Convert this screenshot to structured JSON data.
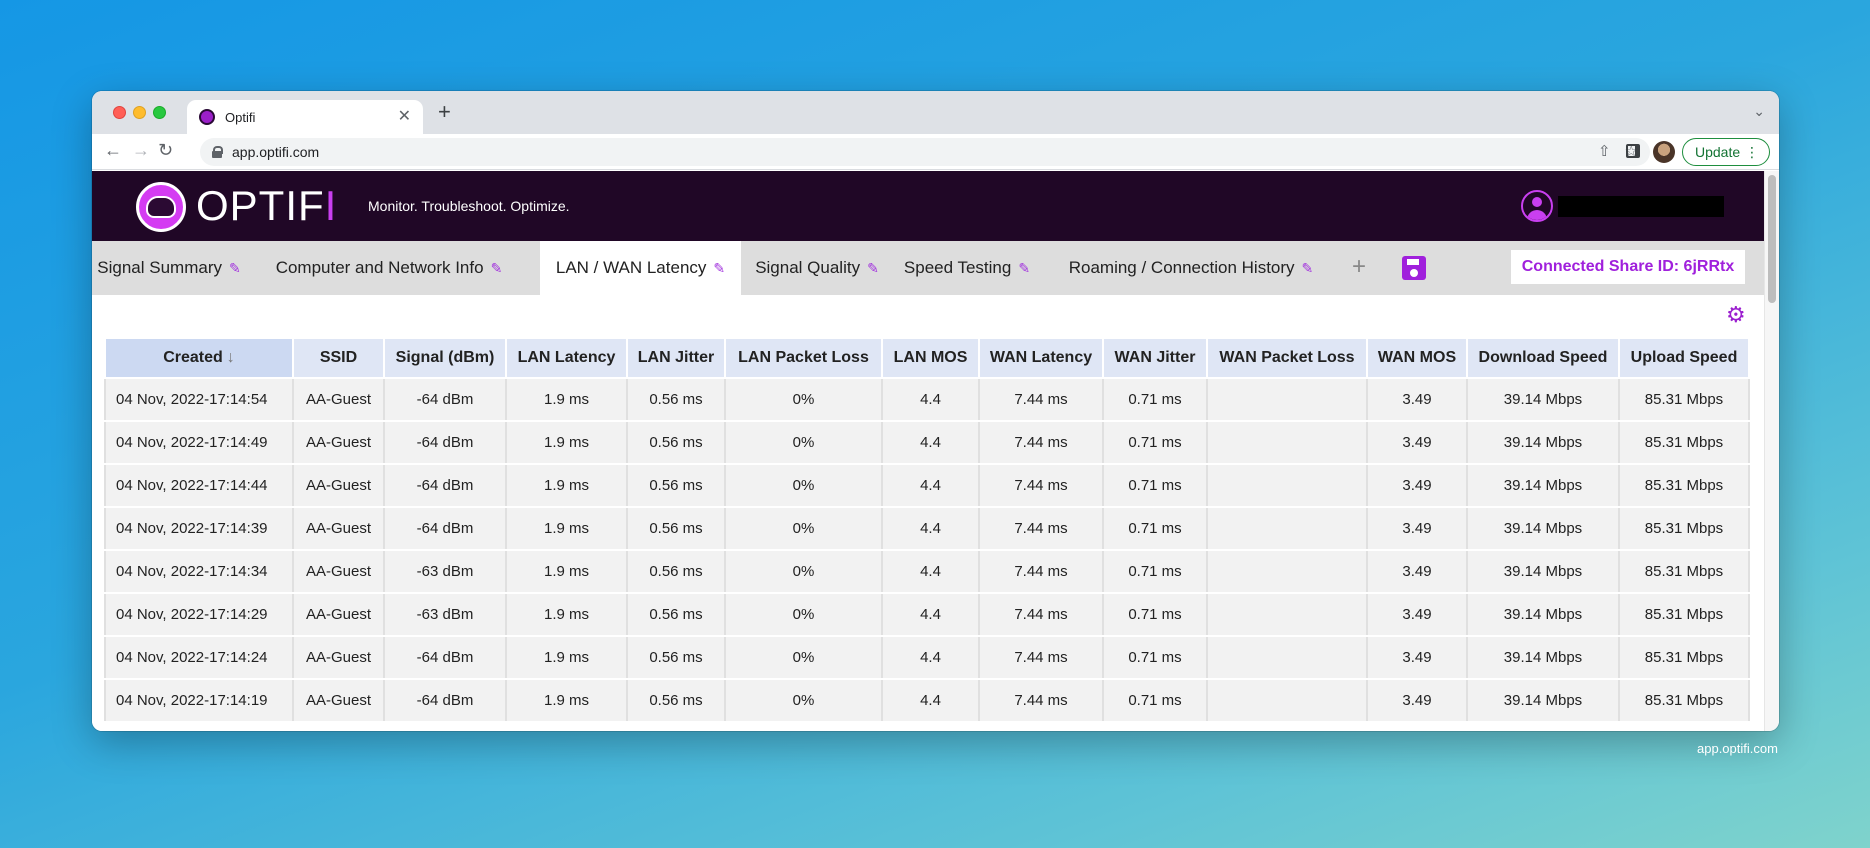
{
  "browser": {
    "tab_title": "Optifi",
    "new_tab_label": "+",
    "url": "app.optifi.com",
    "update_label": "Update"
  },
  "app": {
    "logo_text_main": "OPTIF",
    "logo_text_accent": "I",
    "tagline": "Monitor. Troubleshoot. Optimize."
  },
  "tabs": [
    {
      "label": "Signal Summary"
    },
    {
      "label": "Computer and Network Info"
    },
    {
      "label": "LAN / WAN Latency"
    },
    {
      "label": "Signal Quality"
    },
    {
      "label": "Speed Testing"
    },
    {
      "label": "Roaming / Connection History"
    }
  ],
  "share": {
    "label": "Connected Share ID: 6jRRtx"
  },
  "table": {
    "headers": [
      "Created",
      "SSID",
      "Signal (dBm)",
      "LAN Latency",
      "LAN Jitter",
      "LAN Packet Loss",
      "LAN MOS",
      "WAN Latency",
      "WAN Jitter",
      "WAN Packet Loss",
      "WAN MOS",
      "Download Speed",
      "Upload Speed"
    ],
    "rows": [
      [
        "04 Nov, 2022-17:14:54",
        "AA-Guest",
        "-64 dBm",
        "1.9 ms",
        "0.56 ms",
        "0%",
        "4.4",
        "7.44 ms",
        "0.71 ms",
        "",
        "3.49",
        "39.14 Mbps",
        "85.31 Mbps"
      ],
      [
        "04 Nov, 2022-17:14:49",
        "AA-Guest",
        "-64 dBm",
        "1.9 ms",
        "0.56 ms",
        "0%",
        "4.4",
        "7.44 ms",
        "0.71 ms",
        "",
        "3.49",
        "39.14 Mbps",
        "85.31 Mbps"
      ],
      [
        "04 Nov, 2022-17:14:44",
        "AA-Guest",
        "-64 dBm",
        "1.9 ms",
        "0.56 ms",
        "0%",
        "4.4",
        "7.44 ms",
        "0.71 ms",
        "",
        "3.49",
        "39.14 Mbps",
        "85.31 Mbps"
      ],
      [
        "04 Nov, 2022-17:14:39",
        "AA-Guest",
        "-64 dBm",
        "1.9 ms",
        "0.56 ms",
        "0%",
        "4.4",
        "7.44 ms",
        "0.71 ms",
        "",
        "3.49",
        "39.14 Mbps",
        "85.31 Mbps"
      ],
      [
        "04 Nov, 2022-17:14:34",
        "AA-Guest",
        "-63 dBm",
        "1.9 ms",
        "0.56 ms",
        "0%",
        "4.4",
        "7.44 ms",
        "0.71 ms",
        "",
        "3.49",
        "39.14 Mbps",
        "85.31 Mbps"
      ],
      [
        "04 Nov, 2022-17:14:29",
        "AA-Guest",
        "-63 dBm",
        "1.9 ms",
        "0.56 ms",
        "0%",
        "4.4",
        "7.44 ms",
        "0.71 ms",
        "",
        "3.49",
        "39.14 Mbps",
        "85.31 Mbps"
      ],
      [
        "04 Nov, 2022-17:14:24",
        "AA-Guest",
        "-64 dBm",
        "1.9 ms",
        "0.56 ms",
        "0%",
        "4.4",
        "7.44 ms",
        "0.71 ms",
        "",
        "3.49",
        "39.14 Mbps",
        "85.31 Mbps"
      ],
      [
        "04 Nov, 2022-17:14:19",
        "AA-Guest",
        "-64 dBm",
        "1.9 ms",
        "0.56 ms",
        "0%",
        "4.4",
        "7.44 ms",
        "0.71 ms",
        "",
        "3.49",
        "39.14 Mbps",
        "85.31 Mbps"
      ]
    ]
  },
  "footer": {
    "url": "app.optifi.com"
  },
  "colors": {
    "accent": "#a020dc",
    "header_bg": "#200726",
    "tabbar_bg": "#dddddd"
  },
  "icons": [
    "lock-icon",
    "share-icon",
    "star-icon",
    "gear-icon",
    "save-icon",
    "edit-icon",
    "sort-down-icon",
    "user-icon"
  ]
}
